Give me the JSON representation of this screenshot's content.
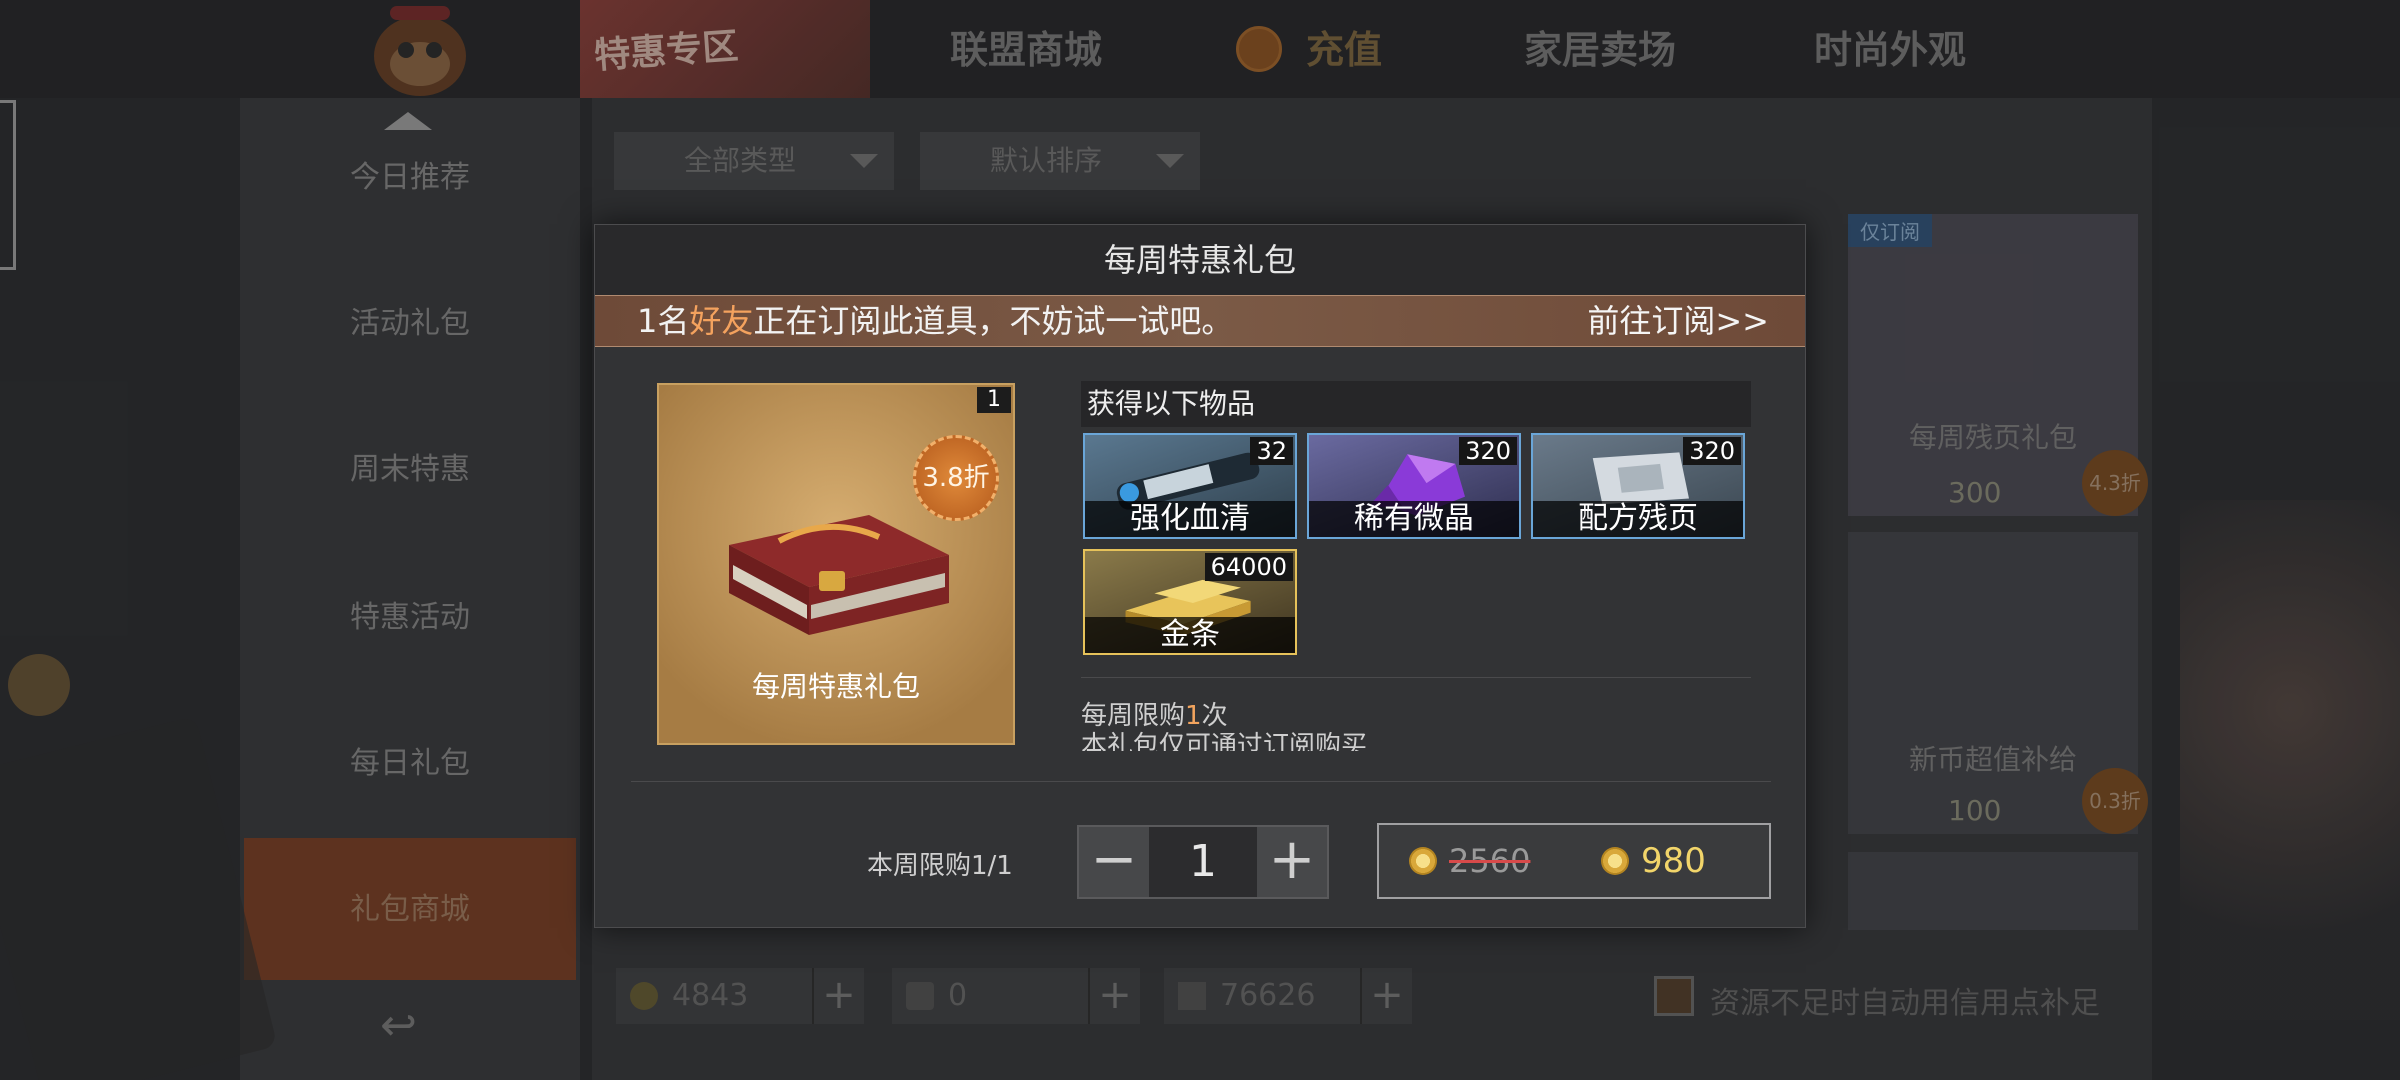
{
  "top_tabs": [
    "特惠专区",
    "联盟商城",
    "充值",
    "家居卖场",
    "时尚外观"
  ],
  "sidebar": {
    "items": [
      "今日推荐",
      "活动礼包",
      "周末特惠",
      "特惠活动",
      "每日礼包",
      "礼包商城"
    ]
  },
  "filters": [
    "全部类型",
    "默认排序"
  ],
  "bg_cards": [
    {
      "tag": "仅订阅",
      "name": "每周残页礼包",
      "price": "300",
      "discount": "4.3折"
    },
    {
      "name": "新币超值补给",
      "price": "100",
      "discount": "0.3折"
    }
  ],
  "currencies": [
    "4843",
    "0",
    "76626"
  ],
  "auto_credit_text": "资源不足时自动用信用点补足",
  "modal": {
    "title": "每周特惠礼包",
    "notice_pre": "1名",
    "notice_highlight": "好友",
    "notice_post": "正在订阅此道具，不妨试一试吧。",
    "notice_link": "前往订阅>>",
    "pack": {
      "name": "每周特惠礼包",
      "count": "1",
      "discount": "3.8折"
    },
    "rewards_header": "获得以下物品",
    "rewards": [
      {
        "name": "强化血清",
        "count": "32"
      },
      {
        "name": "稀有微晶",
        "count": "320"
      },
      {
        "name": "配方残页",
        "count": "320"
      },
      {
        "name": "金条",
        "count": "64000"
      }
    ],
    "limit_week_pre": "每周限购",
    "limit_week_num": "1",
    "limit_week_post": "次",
    "sub_only": "本礼包仅可通过订阅购买",
    "buy_limit": "本周限购1/1",
    "quantity": "1",
    "old_price": "2560",
    "new_price": "980"
  },
  "colors": {
    "accent": "#f2a45e",
    "price": "#f2d56a",
    "notice_bg": "#6e4a38",
    "item_border": "#6aa6d8"
  }
}
